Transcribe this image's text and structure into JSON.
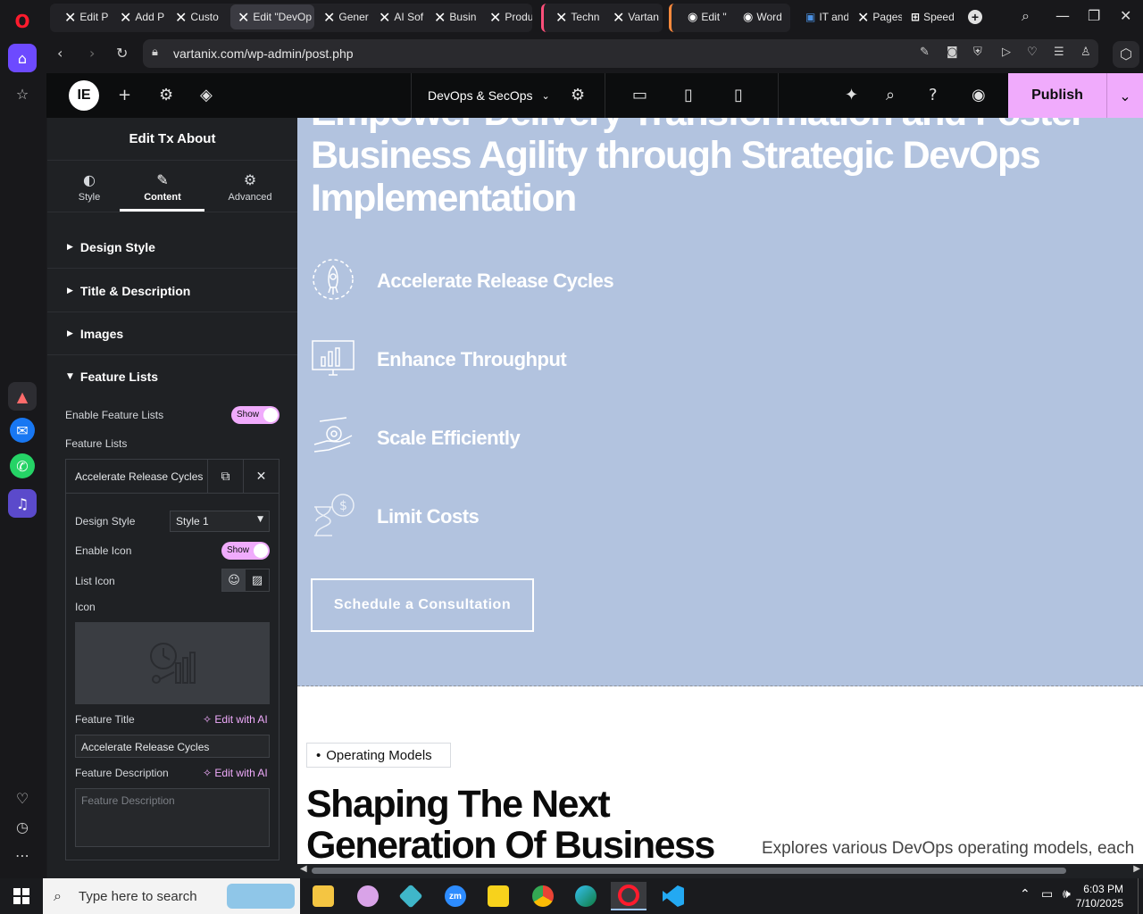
{
  "browser": {
    "tabs": [
      {
        "label": "Edit P"
      },
      {
        "label": "Add P"
      },
      {
        "label": "Custo"
      },
      {
        "label": "Edit \"DevOp"
      },
      {
        "label": "Gener"
      },
      {
        "label": "AI Sof"
      },
      {
        "label": "Busin"
      },
      {
        "label": "Produ"
      },
      {
        "label": "Techn"
      },
      {
        "label": "Vartan"
      },
      {
        "label": "Edit \""
      },
      {
        "label": "Word"
      },
      {
        "label": "IT and"
      },
      {
        "label": "Pages"
      },
      {
        "label": "Speed"
      }
    ],
    "url": "vartanix.com/wp-admin/post.php"
  },
  "editor": {
    "page_selector": "DevOps & SecOps",
    "publish_label": "Publish",
    "panel_title": "Edit Tx About",
    "panel_tabs": [
      {
        "label": "Style",
        "icon": "half-circle-icon"
      },
      {
        "label": "Content",
        "icon": "pencil-icon"
      },
      {
        "label": "Advanced",
        "icon": "gear-icon"
      }
    ],
    "sections": [
      {
        "label": "Design Style"
      },
      {
        "label": "Title & Description"
      },
      {
        "label": "Images"
      },
      {
        "label": "Feature Lists"
      }
    ],
    "feature_lists": {
      "enable_label": "Enable Feature Lists",
      "enable_value": "Show",
      "list_label": "Feature Lists",
      "item_title": "Accelerate Release Cycles",
      "design_style_label": "Design Style",
      "design_style_value": "Style 1",
      "enable_icon_label": "Enable Icon",
      "enable_icon_value": "Show",
      "list_icon_label": "List Icon",
      "icon_label": "Icon",
      "feature_title_label": "Feature Title",
      "edit_ai_label": "Edit with AI",
      "feature_title_value": "Accelerate Release Cycles",
      "feature_desc_label": "Feature Description",
      "feature_desc_placeholder": "Feature Description"
    }
  },
  "canvas": {
    "hero_heading": "Empower Delivery Transformation and Foster Business Agility through Strategic DevOps Implementation",
    "features": [
      {
        "title": "Accelerate Release Cycles",
        "icon": "rocket-icon"
      },
      {
        "title": "Enhance Throughput",
        "icon": "chart-monitor-icon"
      },
      {
        "title": "Scale Efficiently",
        "icon": "hand-gear-icon"
      },
      {
        "title": "Limit Costs",
        "icon": "hourglass-dollar-icon"
      }
    ],
    "cta_label": "Schedule a Consultation",
    "badge": "Operating Models",
    "section2_heading": "Shaping The Next Generation Of Business",
    "section2_desc": "Explores various DevOps operating models, each"
  },
  "taskbar": {
    "search_placeholder": "Type here to search",
    "time": "6:03 PM",
    "date": "7/10/2025"
  },
  "colors": {
    "accent": "#f0abfc",
    "hero_bg": "#b2c3df",
    "panel_bg": "#1f2124",
    "topbar_bg": "#0c0d0e"
  }
}
